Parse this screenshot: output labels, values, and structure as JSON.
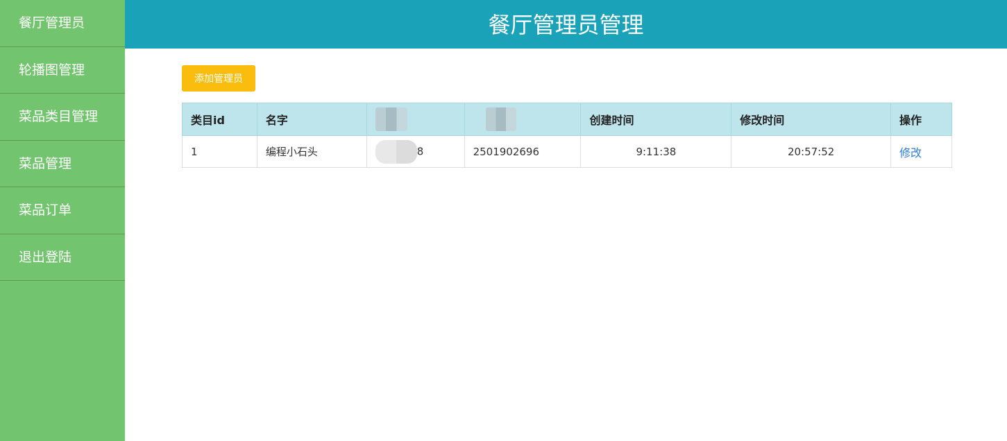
{
  "sidebar": {
    "items": [
      {
        "label": "餐厅管理员"
      },
      {
        "label": "轮播图管理"
      },
      {
        "label": "菜品类目管理"
      },
      {
        "label": "菜品管理"
      },
      {
        "label": "菜品订单"
      },
      {
        "label": "退出登陆"
      }
    ]
  },
  "header": {
    "title": "餐厅管理员管理"
  },
  "toolbar": {
    "add_label": "添加管理员"
  },
  "table": {
    "columns": [
      "类目id",
      "名字",
      "",
      "",
      "创建时间",
      "修改时间",
      "操作"
    ],
    "rows": [
      {
        "id": "1",
        "name": "编程小石头",
        "col3_visible": "8",
        "col4": "2501902696",
        "created": "9:11:38",
        "updated": "20:57:52",
        "action": "修改"
      }
    ]
  },
  "colors": {
    "sidebar_bg": "#72c56e",
    "header_bg": "#1aa3b8",
    "button_bg": "#fbbd0d",
    "table_header_bg": "#bfe5ec",
    "link": "#2f7bd6"
  }
}
